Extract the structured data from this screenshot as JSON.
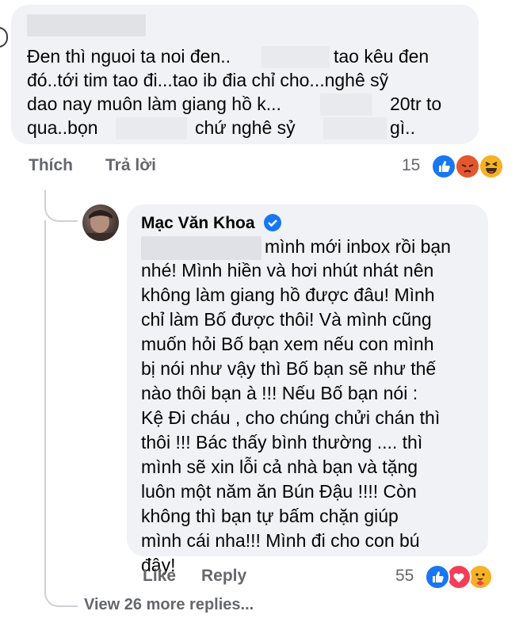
{
  "comment1": {
    "line1_a": "Đen thì nguoi ta noi đen..",
    "line1_b": "tao kêu đen",
    "line2": "đó..tới tim tao đi...tao ib đia chỉ cho...nghê sỹ",
    "line3_a": "dao nay muôn làm giang hồ k...",
    "line3_b": "20tr to",
    "line4_a": "qua..bọn",
    "line4_b": "chứ nghê sỷ",
    "line4_c": "gì..",
    "like_label": "Thích",
    "reply_label": "Trả lời",
    "reaction_count": "15",
    "reactions": [
      "like-reaction",
      "angry-reaction",
      "haha-reaction"
    ]
  },
  "reply": {
    "author": "Mạc Văn Khoa",
    "lines": [
      "mình mới inbox rồi bạn",
      "nhé! Mình hiền và hơi nhút nhát nên",
      "không làm giang hồ được đâu! Mình",
      "chỉ làm Bố được thôi! Và mình cũng",
      "muốn hỏi Bố bạn xem nếu con mình",
      "bị nói như vậy thì Bố bạn sẽ như thế",
      "nào thôi bạn à !!! Nếu Bố bạn nói :",
      "Kệ Đi cháu , cho chúng chửi chán thì",
      "thôi !!! Bác thấy bình thường .... thì",
      "mình sẽ xin lỗi cả nhà bạn và tặng",
      "luôn một năm ăn Bún Đậu !!!! Còn",
      "không thì bạn tự bấm chặn giúp",
      "mình cái nha!!! Mình đi cho con bú",
      "đây!"
    ],
    "like_label": "Like",
    "reply_label": "Reply",
    "reaction_count": "55",
    "reactions": [
      "like-reaction",
      "love-reaction",
      "care-reaction"
    ]
  },
  "more_replies": "View 26 more replies...",
  "colors": {
    "bubble": "#f0f2f5",
    "secondary_text": "#65676b",
    "like_blue": "#1877f2",
    "love_red": "#f33e58",
    "haha_yellow": "#f7b125"
  }
}
